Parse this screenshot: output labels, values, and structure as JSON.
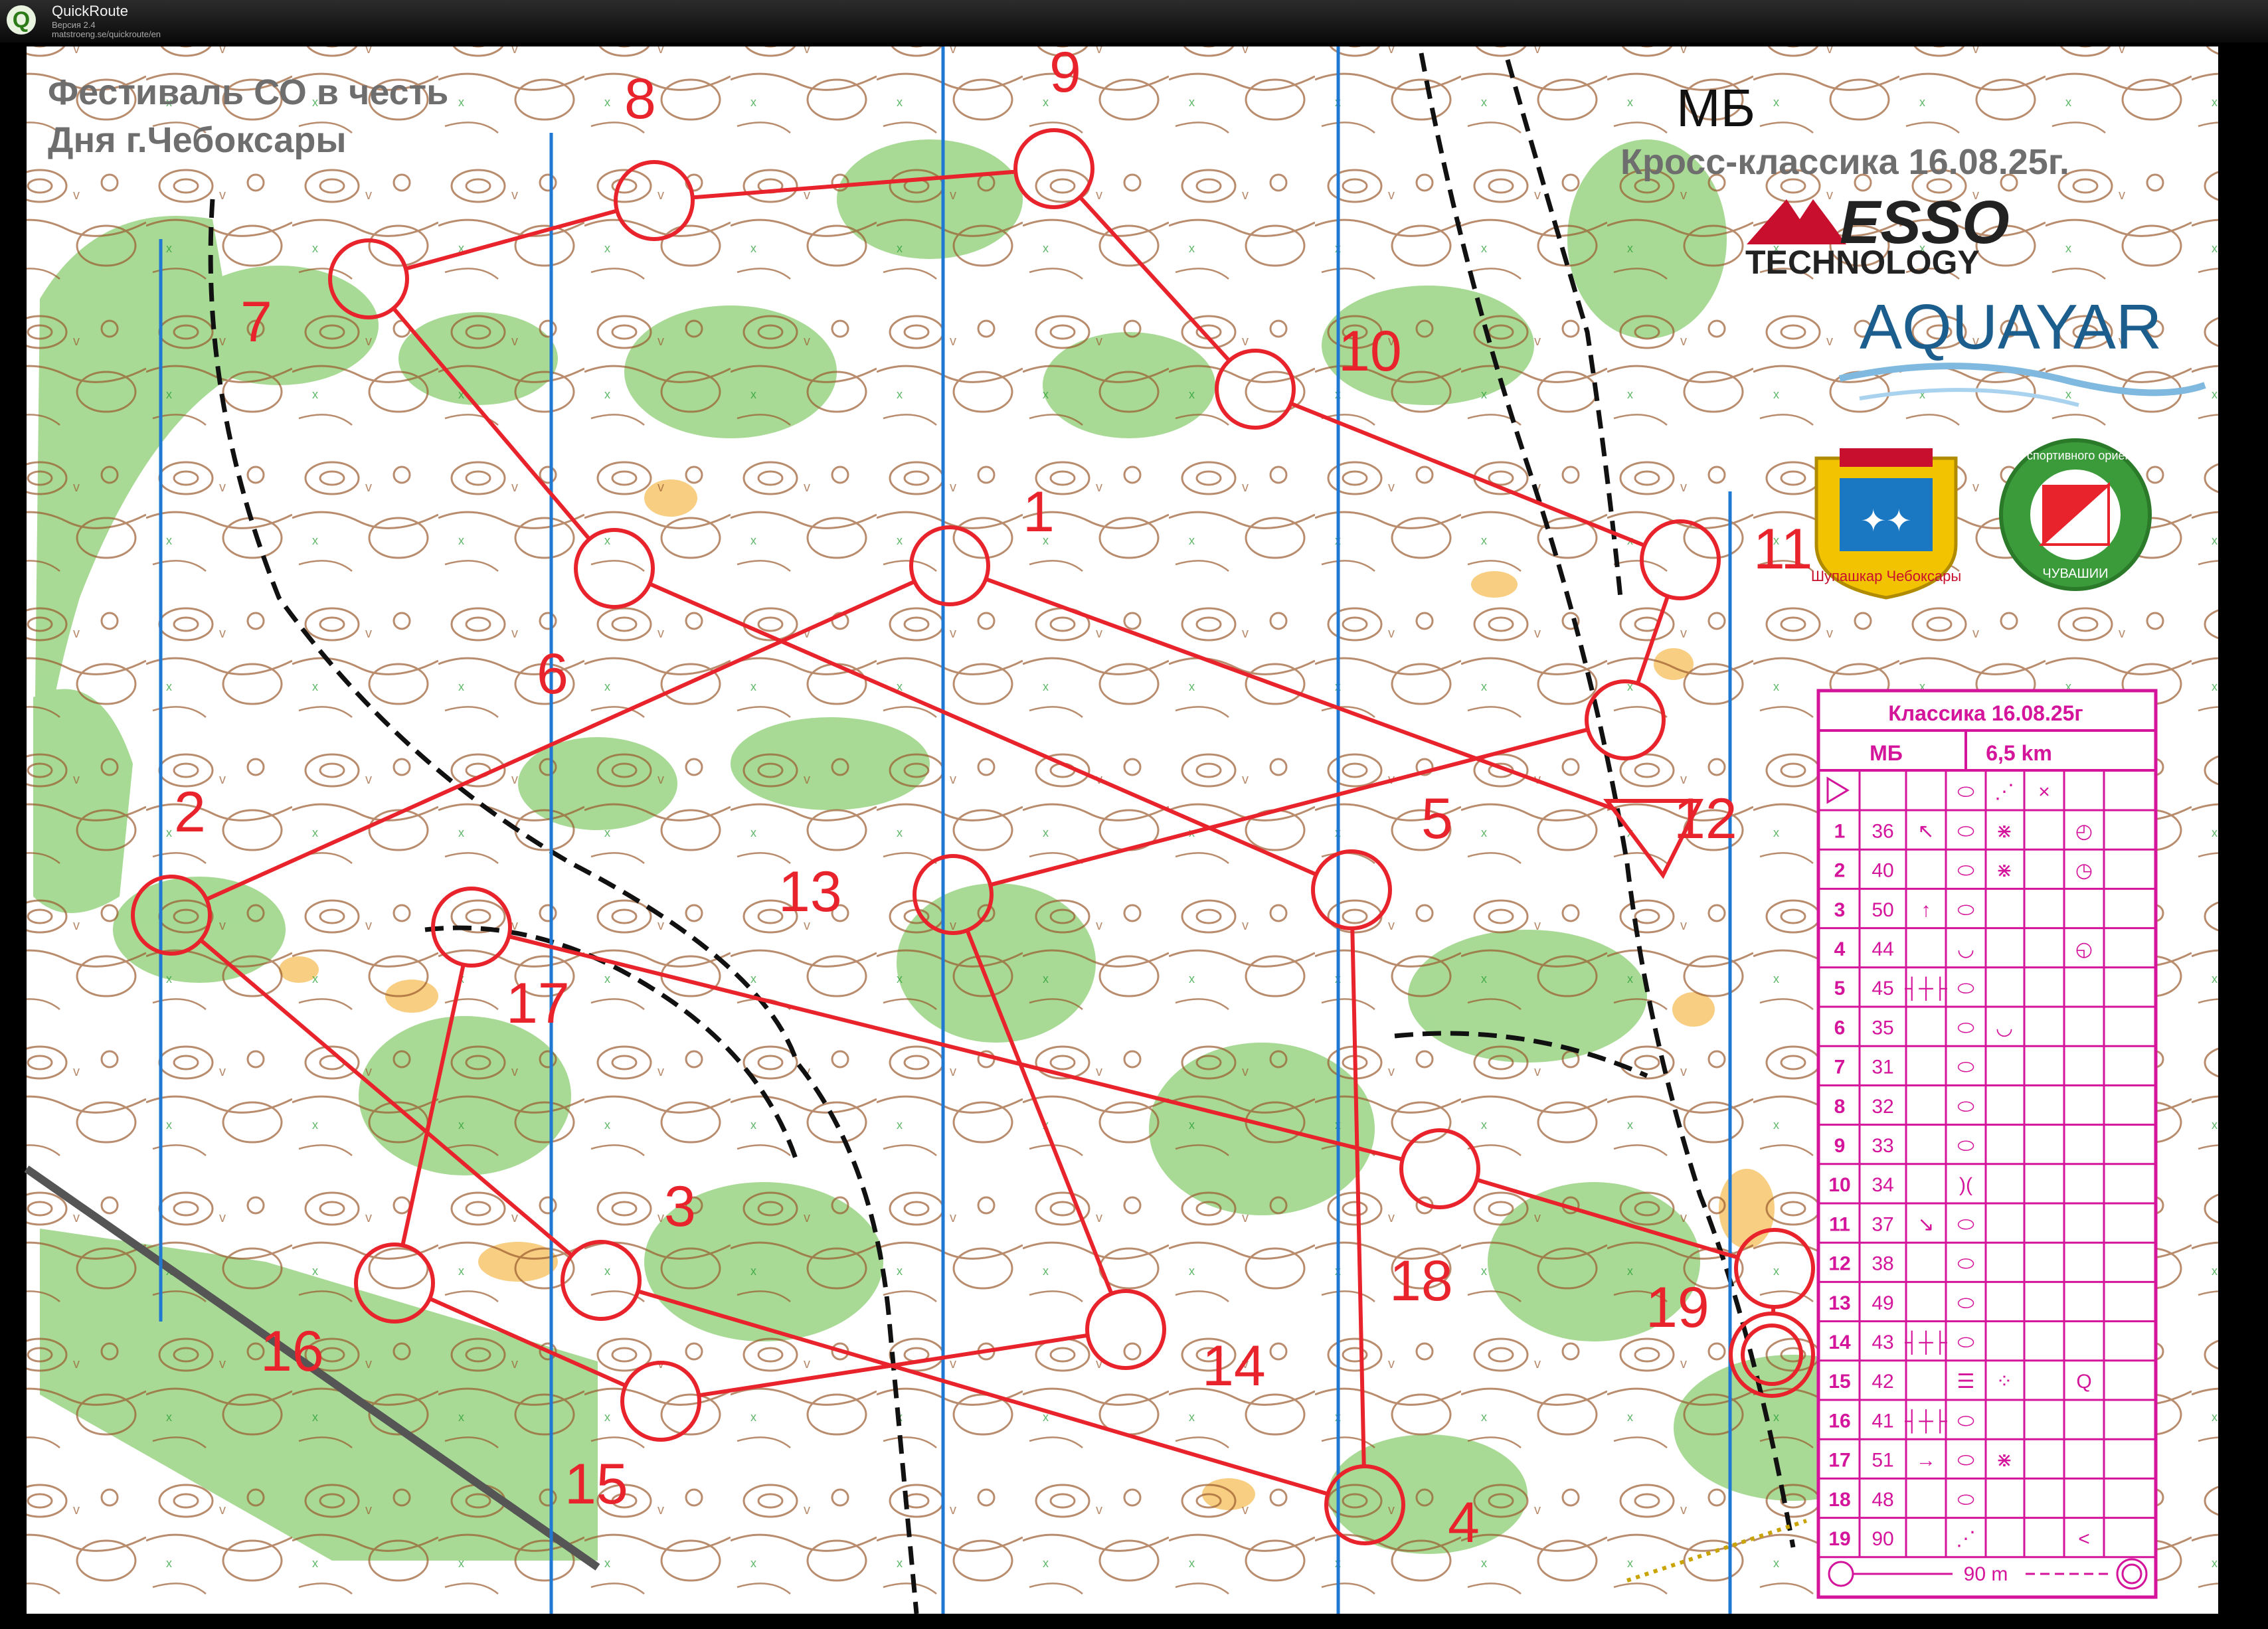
{
  "app": {
    "title": "QuickRoute",
    "version": "Версия 2.4",
    "url": "matstroeng.se/quickroute/en",
    "logo_letter": "Q"
  },
  "map": {
    "event_title_line1": "Фестиваль СО в честь",
    "event_title_line2": "Дня г.Чебоксары",
    "class_name": "МБ",
    "race_title": "Кросс-классика 16.08.25г.",
    "sponsor1_line1": "ESSO",
    "sponsor1_line2": "TECHNOLOGY",
    "sponsor2": "AQUAYAR",
    "emblem_text": "Шупашкар Чебоксары",
    "federation_text_top": "Федерация спортивного ориентирования",
    "federation_text_bottom": "ЧУВАШИИ",
    "colors": {
      "course": "#e8232b",
      "description": "#d4149a",
      "north_lines": "#1f78d1",
      "vegetation": "#9ed68a"
    }
  },
  "controls": [
    {
      "n": "1",
      "label": "1"
    },
    {
      "n": "2",
      "label": "2"
    },
    {
      "n": "3",
      "label": "3"
    },
    {
      "n": "4",
      "label": "4"
    },
    {
      "n": "5",
      "label": "5"
    },
    {
      "n": "6",
      "label": "6"
    },
    {
      "n": "7",
      "label": "7"
    },
    {
      "n": "8",
      "label": "8"
    },
    {
      "n": "9",
      "label": "9"
    },
    {
      "n": "10",
      "label": "10"
    },
    {
      "n": "11",
      "label": "11"
    },
    {
      "n": "12",
      "label": "12"
    },
    {
      "n": "13",
      "label": "13"
    },
    {
      "n": "14",
      "label": "14"
    },
    {
      "n": "15",
      "label": "15"
    },
    {
      "n": "16",
      "label": "16"
    },
    {
      "n": "17",
      "label": "17"
    },
    {
      "n": "18",
      "label": "18"
    },
    {
      "n": "19",
      "label": "19"
    }
  ],
  "description": {
    "title": "Классика 16.08.25г",
    "class": "МБ",
    "length": "6,5 km",
    "rows": [
      {
        "num": "1",
        "code": "36",
        "c": "↖",
        "d": "⬭",
        "e": "⋇",
        "h": "◴"
      },
      {
        "num": "2",
        "code": "40",
        "c": "",
        "d": "⬭",
        "e": "⋇",
        "h": "◷"
      },
      {
        "num": "3",
        "code": "50",
        "c": "↑",
        "d": "⬭",
        "e": "",
        "h": ""
      },
      {
        "num": "4",
        "code": "44",
        "c": "",
        "d": "◡",
        "e": "",
        "h": "◵"
      },
      {
        "num": "5",
        "code": "45",
        "c": "┤┼├",
        "d": "⬭",
        "e": "",
        "h": ""
      },
      {
        "num": "6",
        "code": "35",
        "c": "",
        "d": "⬭",
        "e": "◡",
        "h": ""
      },
      {
        "num": "7",
        "code": "31",
        "c": "",
        "d": "⬭",
        "e": "",
        "h": ""
      },
      {
        "num": "8",
        "code": "32",
        "c": "",
        "d": "⬭",
        "e": "",
        "h": ""
      },
      {
        "num": "9",
        "code": "33",
        "c": "",
        "d": "⬭",
        "e": "",
        "h": ""
      },
      {
        "num": "10",
        "code": "34",
        "c": "",
        "d": ")(",
        "e": "",
        "h": ""
      },
      {
        "num": "11",
        "code": "37",
        "c": "↘",
        "d": "⬭",
        "e": "",
        "h": ""
      },
      {
        "num": "12",
        "code": "38",
        "c": "",
        "d": "⬭",
        "e": "",
        "h": ""
      },
      {
        "num": "13",
        "code": "49",
        "c": "",
        "d": "⬭",
        "e": "",
        "h": ""
      },
      {
        "num": "14",
        "code": "43",
        "c": "┤┼├",
        "d": "⬭",
        "e": "",
        "h": ""
      },
      {
        "num": "15",
        "code": "42",
        "c": "",
        "d": "☰",
        "e": "⁘",
        "h": "Q"
      },
      {
        "num": "16",
        "code": "41",
        "c": "┤┼├",
        "d": "⬭",
        "e": "",
        "h": ""
      },
      {
        "num": "17",
        "code": "51",
        "c": "→",
        "d": "⬭",
        "e": "⋇",
        "h": ""
      },
      {
        "num": "18",
        "code": "48",
        "c": "",
        "d": "⬭",
        "e": "",
        "h": ""
      },
      {
        "num": "19",
        "code": "90",
        "c": "",
        "d": "⋰",
        "e": "",
        "h": "<"
      }
    ],
    "finish_distance": "90 m",
    "start_header": {
      "d": "⬭",
      "e": "⋰",
      "f": "×"
    }
  }
}
